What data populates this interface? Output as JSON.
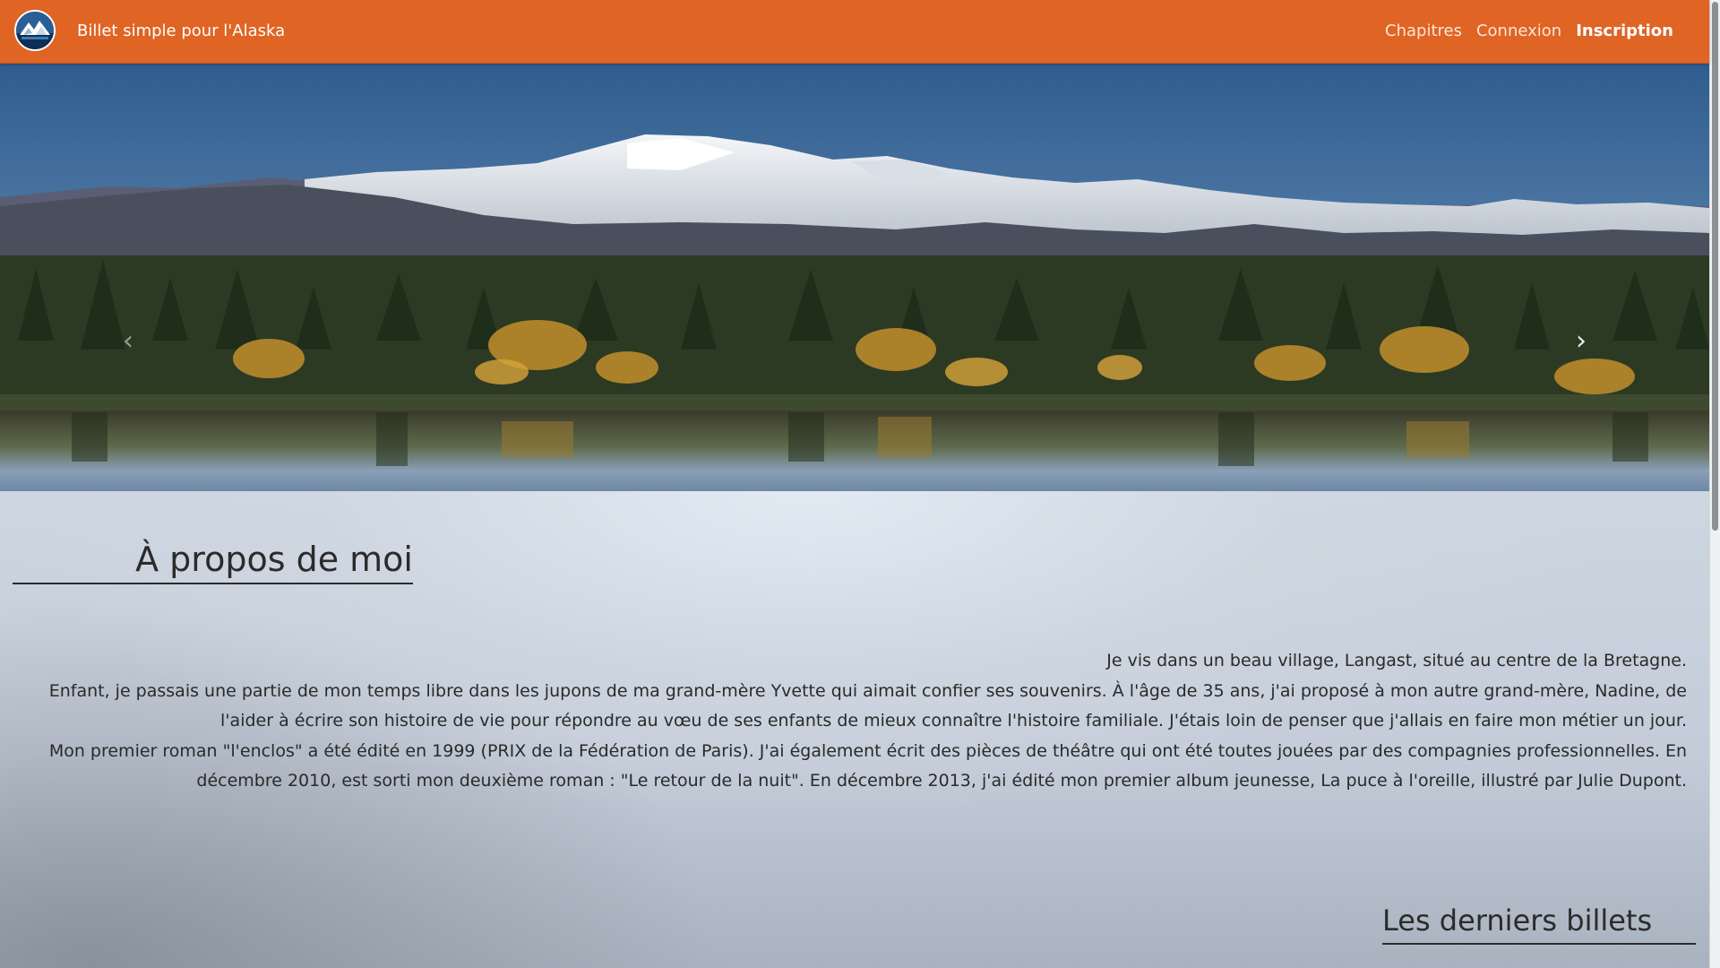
{
  "header": {
    "site_title": "Billet simple pour l'Alaska",
    "logo_icon": "alaska-globe-logo",
    "nav": [
      {
        "label": "Chapitres"
      },
      {
        "label": "Connexion"
      },
      {
        "label": "Inscription",
        "active": true
      }
    ],
    "color": "#e06424"
  },
  "carousel": {
    "prev_icon": "chevron-left",
    "next_icon": "chevron-right",
    "image": "mountain-lake-autumn-forest"
  },
  "about": {
    "title": "À propos de moi",
    "paragraphs": [
      "Je vis dans un beau village, Langast, situé au centre de la Bretagne.",
      "Enfant, je passais une partie de mon temps libre dans les jupons de ma grand-mère Yvette qui aimait confier ses souvenirs. À l'âge de 35 ans, j'ai proposé à mon autre grand-mère, Nadine, de l'aider à écrire son histoire de vie pour répondre au vœu de ses enfants de mieux connaître l'histoire familiale. J'étais loin de penser que j'allais en faire mon métier un jour.",
      "Mon premier roman \"l'enclos\" a été édité en 1999 (PRIX de la Fédération de Paris). J'ai également écrit des pièces de théâtre qui ont été toutes jouées par des compagnies professionnelles. En décembre 2010, est sorti mon deuxième roman : \"Le retour de la nuit\". En décembre 2013, j'ai édité mon premier album jeunesse, La puce à l'oreille, illustré par Julie Dupont."
    ]
  },
  "latest": {
    "title": "Les derniers billets"
  }
}
